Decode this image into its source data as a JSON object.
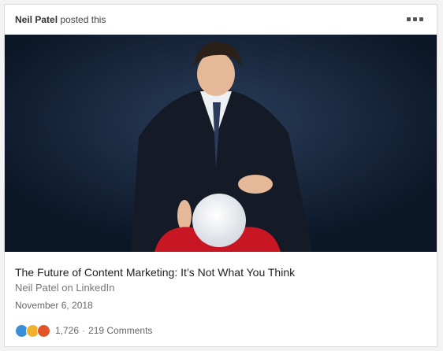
{
  "post": {
    "poster_name": "Neil Patel",
    "poster_action": "posted this"
  },
  "article": {
    "title": "The Future of Content Marketing: It’s Not What You Think",
    "source": "Neil Patel on LinkedIn",
    "date": "November 6, 2018"
  },
  "social": {
    "reactions": [
      "like-icon",
      "insightful-icon",
      "love-icon"
    ],
    "reaction_count": "1,726",
    "separator": "·",
    "comments": "219 Comments"
  },
  "colors": {
    "hero_bg": "#0b1626",
    "cloth": "#c81623",
    "like": "#3b8fd7",
    "insightful": "#f0b22e",
    "love": "#e0562a"
  }
}
